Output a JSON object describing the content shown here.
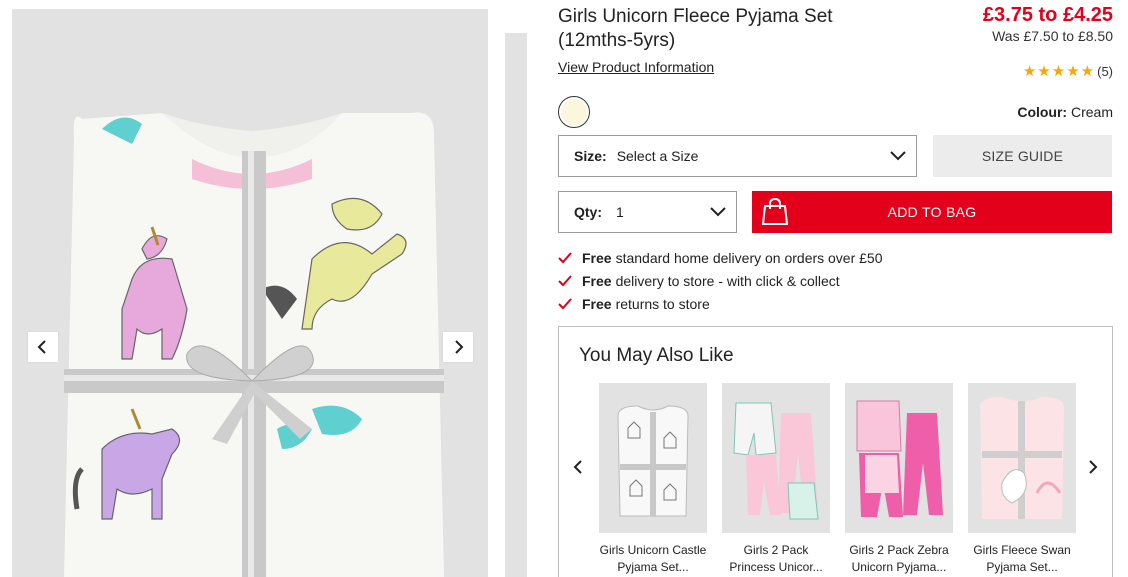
{
  "product": {
    "title": "Girls Unicorn Fleece Pyjama Set (12mths-5yrs)",
    "price_now": "£3.75 to £4.25",
    "price_was": "Was £7.50 to £8.50",
    "view_info": "View Product Information",
    "rating_stars": "★★★★★",
    "rating_count": "(5)",
    "colour_label": "Colour:",
    "colour_value": "Cream",
    "swatch_color": "#fcf6dc"
  },
  "size": {
    "label": "Size:",
    "value": "Select a Size",
    "guide": "SIZE GUIDE"
  },
  "qty": {
    "label": "Qty:",
    "value": "1"
  },
  "add_to_bag": "ADD TO BAG",
  "accent_color": "#e2001a",
  "delivery": [
    {
      "bold": "Free",
      "text": "standard home delivery on orders over £50"
    },
    {
      "bold": "Free",
      "text": "delivery to store - with click & collect"
    },
    {
      "bold": "Free",
      "text": "returns to store"
    }
  ],
  "recs": {
    "title": "You May Also Like",
    "items": [
      {
        "name1": "Girls Unicorn Castle",
        "name2": "Pyjama Set..."
      },
      {
        "name1": "Girls 2 Pack",
        "name2": "Princess Unicor..."
      },
      {
        "name1": "Girls 2 Pack Zebra",
        "name2": "Unicorn Pyjama..."
      },
      {
        "name1": "Girls Fleece Swan",
        "name2": "Pyjama Set..."
      }
    ]
  },
  "icons": {
    "prev": "chevron-left-icon",
    "next": "chevron-right-icon",
    "dropdown": "chevron-down-icon",
    "bag": "shopping-bag-icon",
    "tick": "check-icon"
  }
}
